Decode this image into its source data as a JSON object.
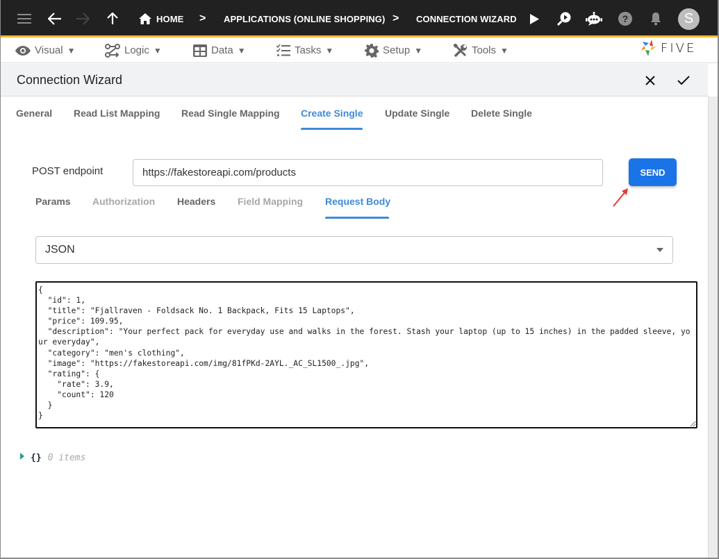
{
  "topbar": {
    "icons": {
      "menu": "hamburger-menu-icon",
      "back": "arrow-left-icon",
      "forward": "arrow-right-icon",
      "up": "arrow-up-icon",
      "home": "home-icon",
      "run": "play-icon",
      "inspect": "search-play-icon",
      "chat": "chatbot-icon",
      "help": "help-icon",
      "notifications": "bell-icon"
    },
    "breadcrumbs": [
      {
        "label": "HOME"
      },
      {
        "label": "APPLICATIONS (ONLINE SHOPPING)"
      },
      {
        "label": "CONNECTION WIZARD"
      }
    ],
    "separator": ">",
    "avatar_initial": "S",
    "accent_color": "#f5b82e"
  },
  "menubar": {
    "items": [
      {
        "label": "Visual",
        "icon": "eye-icon"
      },
      {
        "label": "Logic",
        "icon": "flow-icon"
      },
      {
        "label": "Data",
        "icon": "table-icon"
      },
      {
        "label": "Tasks",
        "icon": "checklist-icon"
      },
      {
        "label": "Setup",
        "icon": "gear-icon"
      },
      {
        "label": "Tools",
        "icon": "tools-icon"
      }
    ],
    "caret": "▼",
    "logo_text": "FIVE"
  },
  "titlebar": {
    "title": "Connection Wizard",
    "close_label": "close",
    "confirm_label": "confirm"
  },
  "tabs": [
    {
      "label": "General",
      "active": false
    },
    {
      "label": "Read List Mapping",
      "active": false
    },
    {
      "label": "Read Single Mapping",
      "active": false
    },
    {
      "label": "Create Single",
      "active": true
    },
    {
      "label": "Update Single",
      "active": false
    },
    {
      "label": "Delete Single",
      "active": false
    }
  ],
  "endpoint": {
    "label": "POST endpoint",
    "value": "https://fakestoreapi.com/products",
    "send_label": "SEND"
  },
  "subtabs": [
    {
      "label": "Params",
      "state": "enabled"
    },
    {
      "label": "Authorization",
      "state": "disabled"
    },
    {
      "label": "Headers",
      "state": "enabled"
    },
    {
      "label": "Field Mapping",
      "state": "disabled"
    },
    {
      "label": "Request Body",
      "state": "active"
    }
  ],
  "body_type": {
    "selected": "JSON"
  },
  "request_body": "{\n  \"id\": 1,\n  \"title\": \"Fjallraven - Foldsack No. 1 Backpack, Fits 15 Laptops\",\n  \"price\": 109.95,\n  \"description\": \"Your perfect pack for everyday use and walks in the forest. Stash your laptop (up to 15 inches) in the padded sleeve, your everyday\",\n  \"category\": \"men's clothing\",\n  \"image\": \"https://fakestoreapi.com/img/81fPKd-2AYL._AC_SL1500_.jpg\",\n  \"rating\": {\n    \"rate\": 3.9,\n    \"count\": 120\n  }\n}",
  "response_viewer": {
    "brace": "{}",
    "count_text": "0 items"
  },
  "colors": {
    "primary": "#1b73e8",
    "tab_active": "#3f8ad8",
    "annotation_arrow": "#e53935"
  }
}
